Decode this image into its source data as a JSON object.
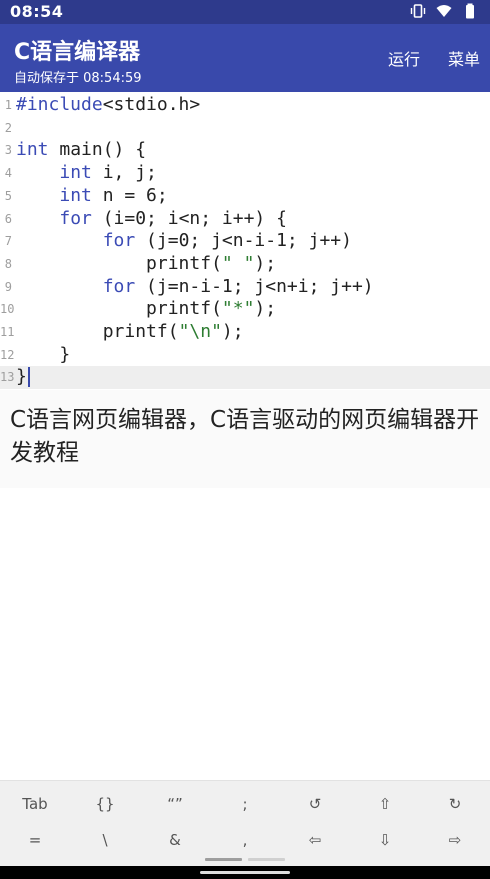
{
  "status_bar": {
    "time": "08:54",
    "icons": [
      "vibrate-icon",
      "wifi-icon",
      "battery-icon"
    ]
  },
  "app_bar": {
    "title": "C语言编译器",
    "subtitle": "自动保存于 08:54:59",
    "actions": {
      "run": "运行",
      "menu": "菜单"
    }
  },
  "editor": {
    "current_line": 13,
    "lines": [
      {
        "num": "1",
        "tokens": [
          {
            "t": "#include",
            "c": "kw"
          },
          {
            "t": "<stdio.h>",
            "c": ""
          }
        ]
      },
      {
        "num": "2",
        "tokens": []
      },
      {
        "num": "3",
        "tokens": [
          {
            "t": "int",
            "c": "kw"
          },
          {
            "t": " main() {",
            "c": ""
          }
        ]
      },
      {
        "num": "4",
        "tokens": [
          {
            "t": "    ",
            "c": ""
          },
          {
            "t": "int",
            "c": "kw"
          },
          {
            "t": " i, j;",
            "c": ""
          }
        ]
      },
      {
        "num": "5",
        "tokens": [
          {
            "t": "    ",
            "c": ""
          },
          {
            "t": "int",
            "c": "kw"
          },
          {
            "t": " n = 6;",
            "c": ""
          }
        ]
      },
      {
        "num": "6",
        "tokens": [
          {
            "t": "    ",
            "c": ""
          },
          {
            "t": "for",
            "c": "kw"
          },
          {
            "t": " (i=0; i<n; i++) {",
            "c": ""
          }
        ]
      },
      {
        "num": "7",
        "tokens": [
          {
            "t": "        ",
            "c": ""
          },
          {
            "t": "for",
            "c": "kw"
          },
          {
            "t": " (j=0; j<n-i-1; j++)",
            "c": ""
          }
        ]
      },
      {
        "num": "8",
        "tokens": [
          {
            "t": "            printf(",
            "c": ""
          },
          {
            "t": "\" \"",
            "c": "str"
          },
          {
            "t": ");",
            "c": ""
          }
        ]
      },
      {
        "num": "9",
        "tokens": [
          {
            "t": "        ",
            "c": ""
          },
          {
            "t": "for",
            "c": "kw"
          },
          {
            "t": " (j=n-i-1; j<n+i; j++)",
            "c": ""
          }
        ]
      },
      {
        "num": "10",
        "tokens": [
          {
            "t": "            printf(",
            "c": ""
          },
          {
            "t": "\"*\"",
            "c": "str"
          },
          {
            "t": ");",
            "c": ""
          }
        ]
      },
      {
        "num": "11",
        "tokens": [
          {
            "t": "        printf(",
            "c": ""
          },
          {
            "t": "\"\\n\"",
            "c": "str"
          },
          {
            "t": ");",
            "c": ""
          }
        ]
      },
      {
        "num": "12",
        "tokens": [
          {
            "t": "    }",
            "c": ""
          }
        ]
      },
      {
        "num": "13",
        "tokens": [
          {
            "t": "}",
            "c": ""
          }
        ]
      }
    ]
  },
  "caption": {
    "text": "C语言网页编辑器，C语言驱动的网页编辑器开发教程"
  },
  "keyboard_bar": {
    "row1": [
      "Tab",
      "{}",
      "“”",
      ";",
      "↺",
      "⇧",
      "↻"
    ],
    "row2": [
      "=",
      "\\",
      "&",
      ",",
      "⇦",
      "⇩",
      "⇨"
    ]
  }
}
